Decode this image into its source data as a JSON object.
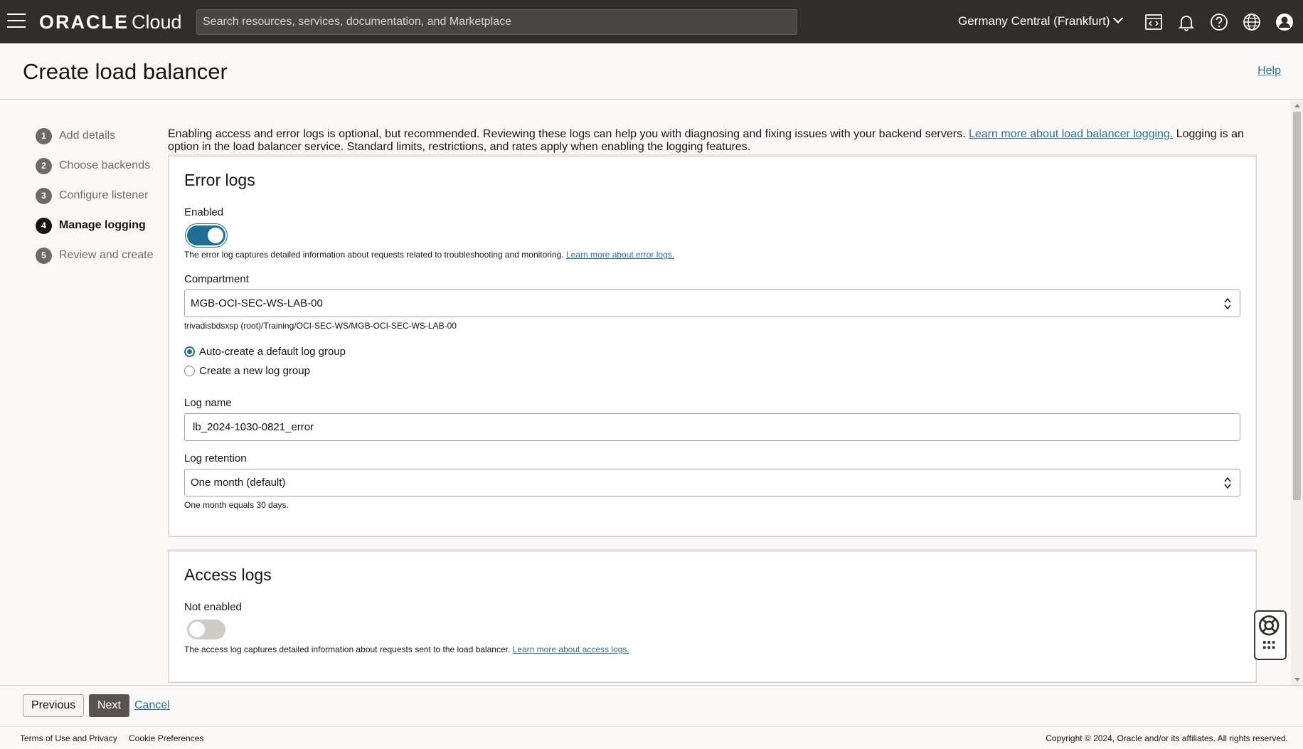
{
  "topbar": {
    "logo_oracle": "ORACLE",
    "logo_cloud": "Cloud",
    "search_placeholder": "Search resources, services, documentation, and Marketplace",
    "region": "Germany Central (Frankfurt)"
  },
  "header": {
    "title": "Create load balancer",
    "help": "Help"
  },
  "steps": [
    {
      "num": "1",
      "label": "Add details"
    },
    {
      "num": "2",
      "label": "Choose backends"
    },
    {
      "num": "3",
      "label": "Configure listener"
    },
    {
      "num": "4",
      "label": "Manage logging"
    },
    {
      "num": "5",
      "label": "Review and create"
    }
  ],
  "intro": {
    "text_before": "Enabling access and error logs is optional, but recommended. Reviewing these logs can help you with diagnosing and fixing issues with your backend servers. ",
    "link": "Learn more about load balancer logging.",
    "text_after": " Logging is an option in the load balancer service. Standard limits, restrictions, and rates apply when enabling the logging features."
  },
  "error_logs": {
    "title": "Error logs",
    "toggle_label": "Enabled",
    "hint_text": "The error log captures detailed information about requests related to troubleshooting and monitoring. ",
    "hint_link": "Learn more about error logs.",
    "compartment_label": "Compartment",
    "compartment_value": "MGB-OCI-SEC-WS-LAB-00",
    "compartment_path": "trivadisbdsxsp (root)/Training/OCI-SEC-WS/MGB-OCI-SEC-WS-LAB-00",
    "radio_auto": "Auto-create a default log group",
    "radio_new": "Create a new log group",
    "log_name_label": "Log name",
    "log_name_value": "lb_2024-1030-0821_error",
    "retention_label": "Log retention",
    "retention_value": "One month (default)",
    "retention_hint": "One month equals 30 days."
  },
  "access_logs": {
    "title": "Access logs",
    "toggle_label": "Not enabled",
    "hint_text": "The access log captures detailed information about requests sent to the load balancer. ",
    "hint_link": "Learn more about access logs."
  },
  "actions": {
    "previous": "Previous",
    "next": "Next",
    "cancel": "Cancel"
  },
  "footer": {
    "terms": "Terms of Use and Privacy",
    "cookies": "Cookie Preferences",
    "copyright": "Copyright © 2024, Oracle and/or its affiliates. All rights reserved."
  }
}
